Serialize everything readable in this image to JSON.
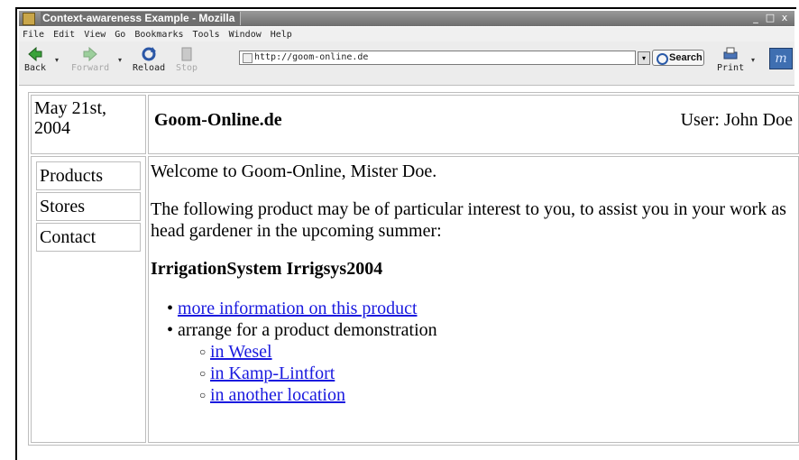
{
  "window": {
    "title": "Context-awareness Example - Mozilla",
    "controls": [
      "_",
      "□",
      "x"
    ]
  },
  "menu": [
    "File",
    "Edit",
    "View",
    "Go",
    "Bookmarks",
    "Tools",
    "Window",
    "Help"
  ],
  "toolbar": {
    "back": "Back",
    "forward": "Forward",
    "reload": "Reload",
    "stop": "Stop",
    "url": "http://goom-online.de",
    "search": "Search",
    "print": "Print"
  },
  "page": {
    "date": "May 21st, 2004",
    "site_title": "Goom-Online.de",
    "user": "User: John Doe",
    "nav": [
      "Products",
      "Stores",
      "Contact"
    ],
    "welcome": "Welcome to Goom-Online, Mister Doe.",
    "intro": "The following product may be of particular interest to you, to assist you in your work as head gardener in the upcoming summer:",
    "product": "IrrigationSystem Irrigsys2004",
    "more_info_link": "more information on this product",
    "demo_text": "arrange for a product demonstration",
    "locations": [
      "in Wesel",
      "in Kamp-Lintfort",
      "in another location"
    ]
  }
}
